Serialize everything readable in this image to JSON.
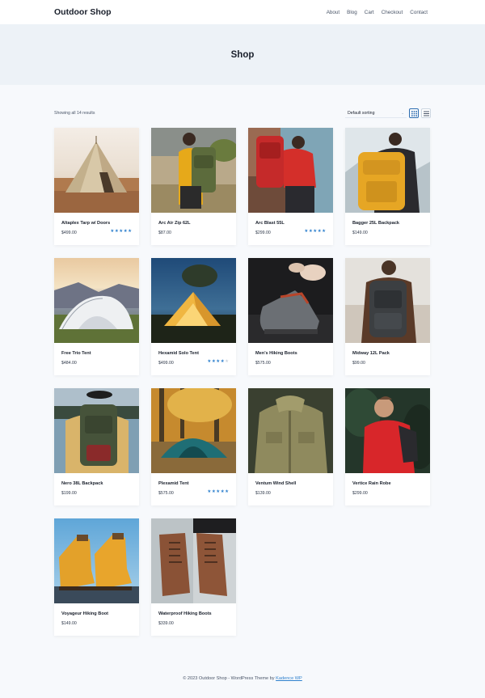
{
  "header": {
    "site_title": "Outdoor Shop",
    "nav": [
      "About",
      "Blog",
      "Cart",
      "Checkout",
      "Contact"
    ]
  },
  "hero": {
    "title": "Shop"
  },
  "toolbar": {
    "result_count": "Showing all 14 results",
    "sort_selected": "Default sorting",
    "view_modes": [
      "grid-view-icon",
      "list-view-icon"
    ],
    "active_view": "grid"
  },
  "products": [
    {
      "name": "Altaplex Tarp w/ Doors",
      "price": "$499.00",
      "rating": 5,
      "image": "bell-tent-desert"
    },
    {
      "name": "Arc Air Zip 62L",
      "price": "$87.00",
      "rating": 0,
      "image": "hiker-green-pack-yellow-jacket"
    },
    {
      "name": "Arc Blast 55L",
      "price": "$299.00",
      "rating": 5,
      "image": "hiker-red-pack-cliff"
    },
    {
      "name": "Bagger 25L Backpack",
      "price": "$149.00",
      "rating": 0,
      "image": "yellow-backpack-mountains"
    },
    {
      "name": "Free Trio Tent",
      "price": "$484.00",
      "rating": 0,
      "image": "white-tent-sunset"
    },
    {
      "name": "Hexamid Solo Tent",
      "price": "$499.00",
      "rating": 4,
      "image": "lit-tent-lake-dusk"
    },
    {
      "name": "Men's Hiking Boots",
      "price": "$575.00",
      "rating": 0,
      "image": "lacing-boot"
    },
    {
      "name": "Midway 12L Pack",
      "price": "$99.00",
      "rating": 0,
      "image": "grey-backpack-field"
    },
    {
      "name": "Nero 38L Backpack",
      "price": "$199.00",
      "rating": 0,
      "image": "hiker-green-pack-lake"
    },
    {
      "name": "Plexamid Tent",
      "price": "$575.00",
      "rating": 5,
      "image": "teal-tent-autumn"
    },
    {
      "name": "Ventum Wind Shell",
      "price": "$139.00",
      "rating": 0,
      "image": "olive-jacket"
    },
    {
      "name": "Vertice Rain Robe",
      "price": "$299.00",
      "rating": 0,
      "image": "red-jacket-forest"
    },
    {
      "name": "Voyageur Hiking Boot",
      "price": "$149.00",
      "rating": 0,
      "image": "yellow-boots"
    },
    {
      "name": "Waterproof Hiking Boots",
      "price": "$339.00",
      "rating": 0,
      "image": "brown-boots"
    }
  ],
  "footer": {
    "text": "© 2023 Outdoor Shop - WordPress Theme by ",
    "link": "Kadence WP"
  },
  "colors": {
    "accent": "#3182ce",
    "page_bg": "#f7f9fc",
    "hero_bg": "#edf2f7",
    "star_off": "#cbd5e0"
  }
}
